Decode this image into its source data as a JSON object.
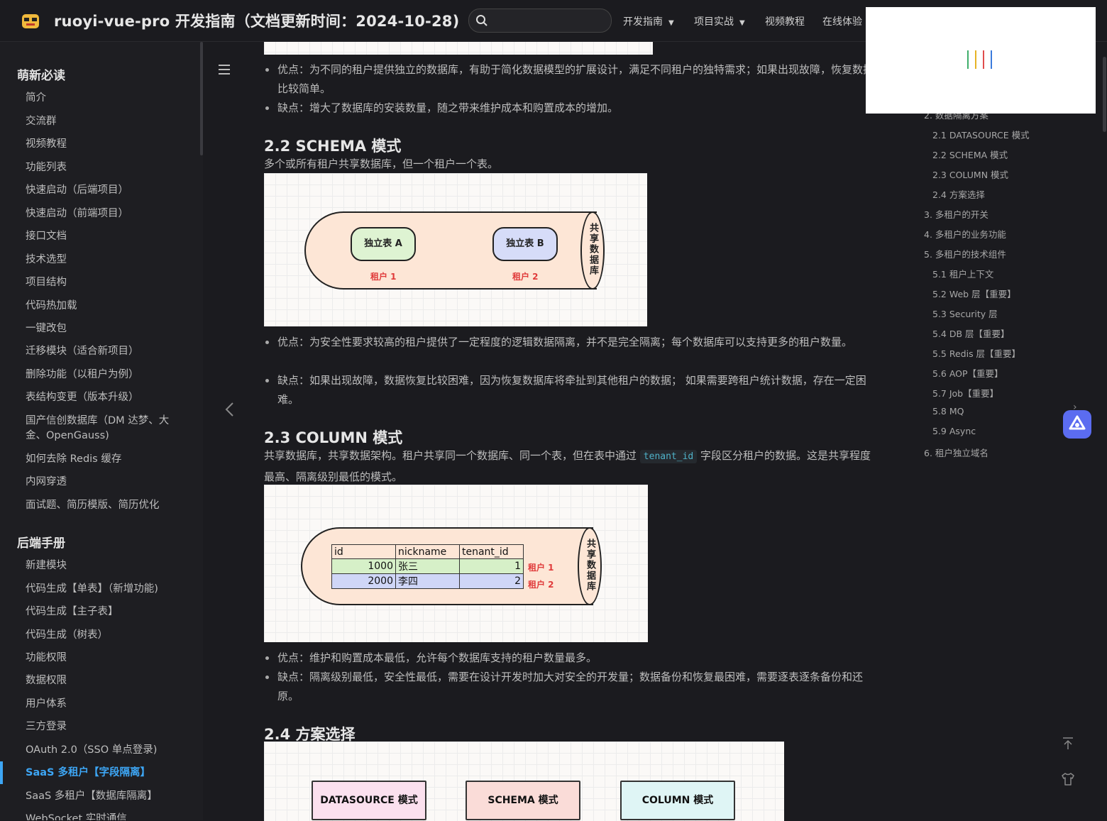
{
  "header": {
    "title": "ruoyi-vue-pro 开发指南（文档更新时间：2024-10-28)",
    "search_placeholder": "",
    "nav": [
      {
        "label": "开发指南",
        "dropdown": true
      },
      {
        "label": "项目实战",
        "dropdown": true
      },
      {
        "label": "视频教程",
        "dropdown": false
      },
      {
        "label": "在线体验",
        "dropdown": false
      }
    ]
  },
  "sidebar": {
    "groups": [
      {
        "title": "萌新必读",
        "items": [
          "简介",
          "交流群",
          "视频教程",
          "功能列表",
          "快速启动（后端项目）",
          "快速启动（前端项目）",
          "接口文档",
          "技术选型",
          "项目结构",
          "代码热加载",
          "一键改包",
          "迁移模块（适合新项目）",
          "删除功能（以租户为例）",
          "表结构变更（版本升级）",
          "国产信创数据库（DM 达梦、大金、OpenGauss)",
          "如何去除 Redis 缓存",
          "内网穿透",
          "面试题、简历模版、简历优化"
        ]
      },
      {
        "title": "后端手册",
        "items": [
          "新建模块",
          "代码生成【单表】（新增功能)",
          "代码生成【主子表】",
          "代码生成（树表）",
          "功能权限",
          "数据权限",
          "用户体系",
          "三方登录",
          "OAuth 2.0（SSO 单点登录)",
          "SaaS 多租户【字段隔离】",
          "SaaS 多租户【数据库隔离】",
          "WebSocket 实时通信"
        ]
      }
    ],
    "active_item": "SaaS 多租户【字段隔离】"
  },
  "content": {
    "section1_pros": "优点：为不同的租户提供独立的数据库，有助于简化数据模型的扩展设计，满足不同租户的独特需求；如果出现故障，恢复数据比较简单。",
    "section1_cons": "缺点：增大了数据库的安装数量，随之带来维护成本和购置成本的增加。",
    "h_schema": "2.2 SCHEMA 模式",
    "schema_desc": "多个或所有租户共享数据库，但一个租户一个表。",
    "schema_diagram": {
      "table_a": "独立表 A",
      "table_b": "独立表 B",
      "tenant1": "租户 1",
      "tenant2": "租户 2",
      "shared_db": "共享数据库"
    },
    "schema_pros": "优点：为安全性要求较高的租户提供了一定程度的逻辑数据隔离，并不是完全隔离；每个数据库可以支持更多的租户数量。",
    "schema_cons": "缺点：如果出现故障，数据恢复比较困难，因为恢复数据库将牵扯到其他租户的数据； 如果需要跨租户统计数据，存在一定困难。",
    "h_column": "2.3 COLUMN 模式",
    "column_desc_pre": "共享数据库，共享数据架构。租户共享同一个数据库、同一个表，但在表中通过",
    "column_desc_code": "tenant_id",
    "column_desc_post": "字段区分租户的数据。这是共享程度最高、隔离级别最低的模式。",
    "column_diagram": {
      "headers": [
        "id",
        "nickname",
        "tenant_id"
      ],
      "rows": [
        [
          "1000",
          "张三",
          "1"
        ],
        [
          "2000",
          "李四",
          "2"
        ]
      ],
      "tenant1": "租户 1",
      "tenant2": "租户 2",
      "shared_db": "共享数据库",
      "row1_color": "#d6f0c8",
      "row2_color": "#cfd6f7"
    },
    "column_pros": "优点：维护和购置成本最低，允许每个数据库支持的租户数量最多。",
    "column_cons": "缺点：隔离级别最低，安全性最低，需要在设计开发时加大对安全的开发量；数据备份和恢复最困难，需要逐表逐条备份和还原。",
    "h_choice": "2.4 方案选择",
    "choice_boxes": [
      {
        "label": "DATASOURCE 模式",
        "color": "#fbe0ee"
      },
      {
        "label": "SCHEMA 模式",
        "color": "#fadcd8"
      },
      {
        "label": "COLUMN 模式",
        "color": "#dff5f5"
      }
    ]
  },
  "toc": {
    "items": [
      {
        "label": "2. 数据隔离方案",
        "level": 1
      },
      {
        "label": "2.1 DATASOURCE 模式",
        "level": 2
      },
      {
        "label": "2.2 SCHEMA 模式",
        "level": 2
      },
      {
        "label": "2.3 COLUMN 模式",
        "level": 2
      },
      {
        "label": "2.4 方案选择",
        "level": 2
      },
      {
        "label": "3. 多租户的开关",
        "level": 1
      },
      {
        "label": "4. 多租户的业务功能",
        "level": 1
      },
      {
        "label": "5. 多租户的技术组件",
        "level": 1
      },
      {
        "label": "5.1 租户上下文",
        "level": 2
      },
      {
        "label": "5.2 Web 层【重要】",
        "level": 2
      },
      {
        "label": "5.3 Security 层",
        "level": 2
      },
      {
        "label": "5.4 DB 层【重要】",
        "level": 2
      },
      {
        "label": "5.5 Redis 层【重要】",
        "level": 2
      },
      {
        "label": "5.6 AOP【重要】",
        "level": 2
      },
      {
        "label": "5.7 Job【重要】",
        "level": 2
      },
      {
        "label": "5.8 MQ",
        "level": 2
      },
      {
        "label": "5.9 Async",
        "level": 2
      },
      {
        "label": "6. 租户独立域名",
        "level": 1
      }
    ]
  },
  "colors": {
    "accent": "#3da6f5",
    "popup_bars": [
      "#3fae6b",
      "#e6b325",
      "#e04d4d",
      "#3b7bdc"
    ]
  },
  "icons": {
    "search": "search-icon",
    "menu": "hamburger-icon",
    "prev": "chevron-left-icon",
    "back_to_top": "arrow-up-icon",
    "theme": "shirt-icon",
    "assistant": "assistant-icon"
  }
}
